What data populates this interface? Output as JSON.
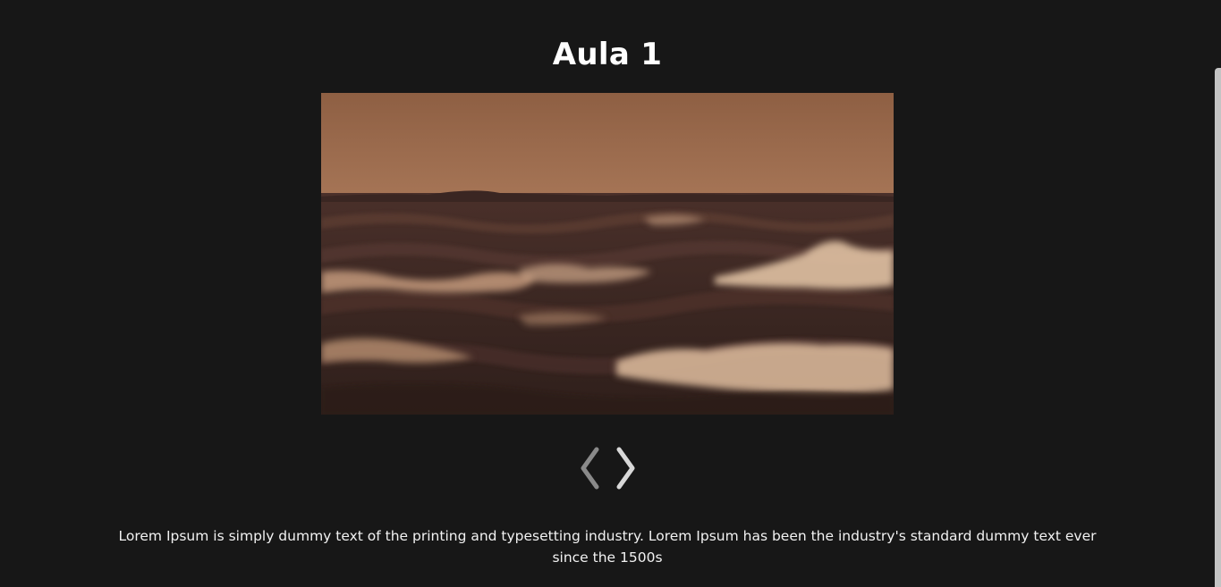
{
  "lesson": {
    "title": "Aula 1",
    "description": "Lorem Ipsum is simply dummy text of the printing and typesetting industry. Lorem Ipsum has been the industry's standard dummy text ever since the 1500s"
  },
  "video": {
    "subject": "ocean-waves-sunset"
  },
  "navigation": {
    "prev_icon": "chevron-left-icon",
    "next_icon": "chevron-right-icon"
  },
  "colors": {
    "background": "#171717",
    "text": "#ffffff",
    "prev_arrow": "#8a8a8a",
    "next_arrow": "#d8d8d8"
  }
}
